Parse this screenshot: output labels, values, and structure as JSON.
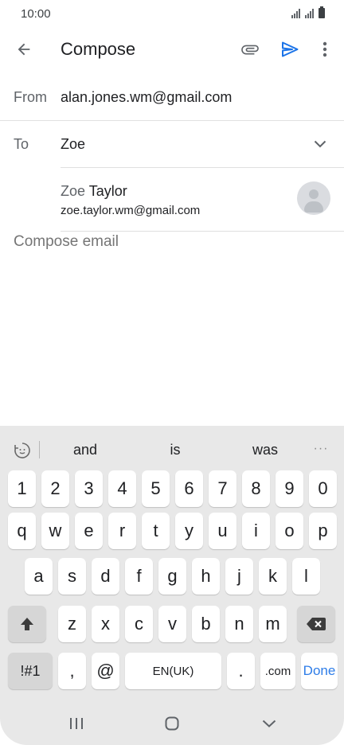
{
  "status": {
    "time": "10:00"
  },
  "app_bar": {
    "title": "Compose"
  },
  "from": {
    "label": "From",
    "value": "alan.jones.wm@gmail.com"
  },
  "to": {
    "label": "To",
    "value": "Zoe"
  },
  "suggestion": {
    "name_match": "Zoe",
    "name_rest": " Taylor",
    "email": "zoe.taylor.wm@gmail.com"
  },
  "body": {
    "placeholder": "Compose email"
  },
  "colors": {
    "accent": "#1a73e8",
    "done_key": "#2e7de8",
    "keyboard_bg": "#e8e8e8"
  },
  "keyboard": {
    "predictions": [
      "and",
      "is",
      "was"
    ],
    "row_numbers": [
      "1",
      "2",
      "3",
      "4",
      "5",
      "6",
      "7",
      "8",
      "9",
      "0"
    ],
    "row_1": [
      "q",
      "w",
      "e",
      "r",
      "t",
      "y",
      "u",
      "i",
      "o",
      "p"
    ],
    "row_2": [
      "a",
      "s",
      "d",
      "f",
      "g",
      "h",
      "j",
      "k",
      "l"
    ],
    "row_3": [
      "z",
      "x",
      "c",
      "v",
      "b",
      "n",
      "m"
    ],
    "symbols_key": "!#1",
    "comma_key": ",",
    "at_key": "@",
    "space_key": "EN(UK)",
    "period_key": ".",
    "dotcom_key": ".com",
    "done_key": "Done"
  }
}
